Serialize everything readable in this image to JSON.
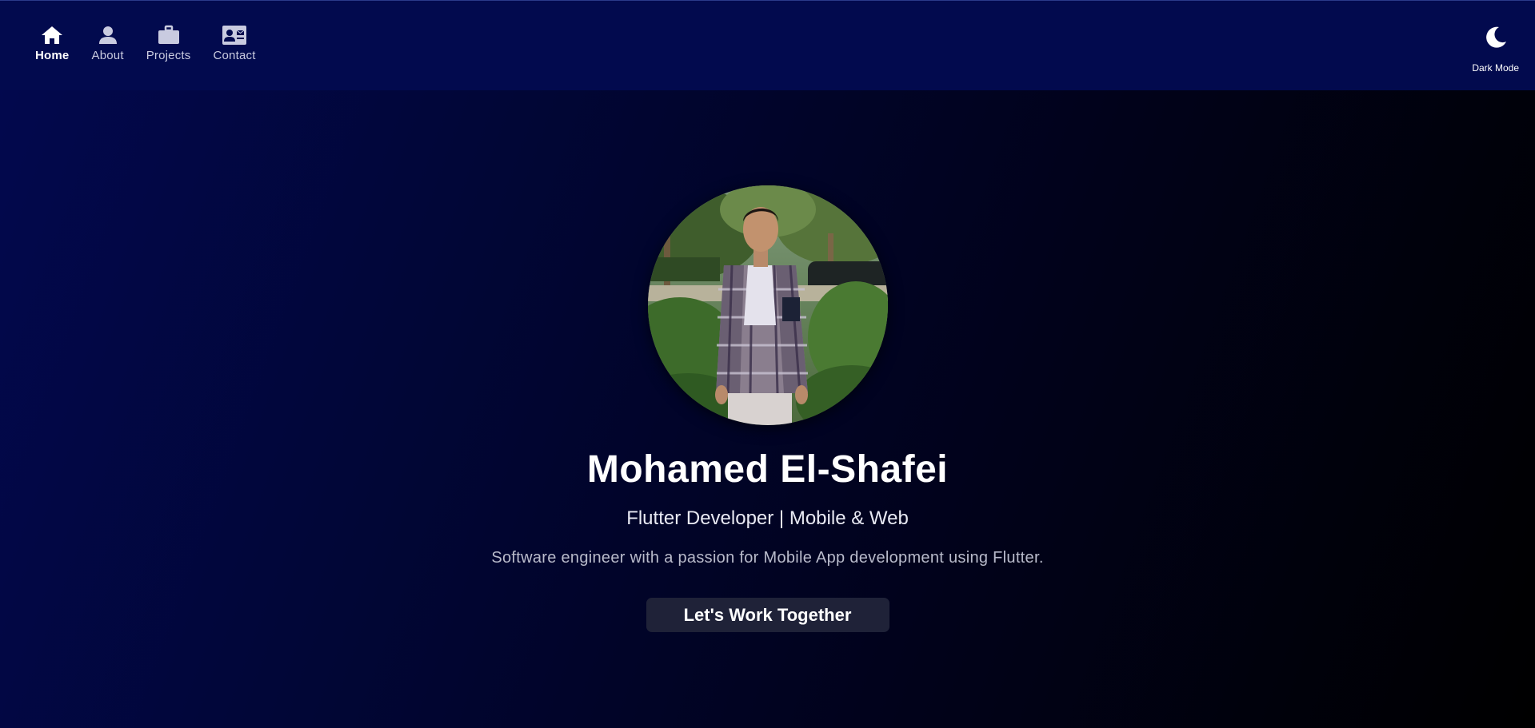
{
  "nav": {
    "items": [
      {
        "label": "Home",
        "icon": "home-icon",
        "active": true
      },
      {
        "label": "About",
        "icon": "person-icon",
        "active": false
      },
      {
        "label": "Projects",
        "icon": "briefcase-icon",
        "active": false
      },
      {
        "label": "Contact",
        "icon": "contact-card-icon",
        "active": false
      }
    ]
  },
  "theme_toggle": {
    "label": "Dark Mode",
    "icon": "moon-icon"
  },
  "hero": {
    "name": "Mohamed El-Shafei",
    "role": "Flutter Developer | Mobile & Web",
    "tagline": "Software engineer with a passion for Mobile App development using Flutter.",
    "cta_label": "Let's Work Together"
  },
  "colors": {
    "navbar": "#020a4e",
    "background_start": "#02084f",
    "background_end": "#000000",
    "button": "#1f2238"
  }
}
